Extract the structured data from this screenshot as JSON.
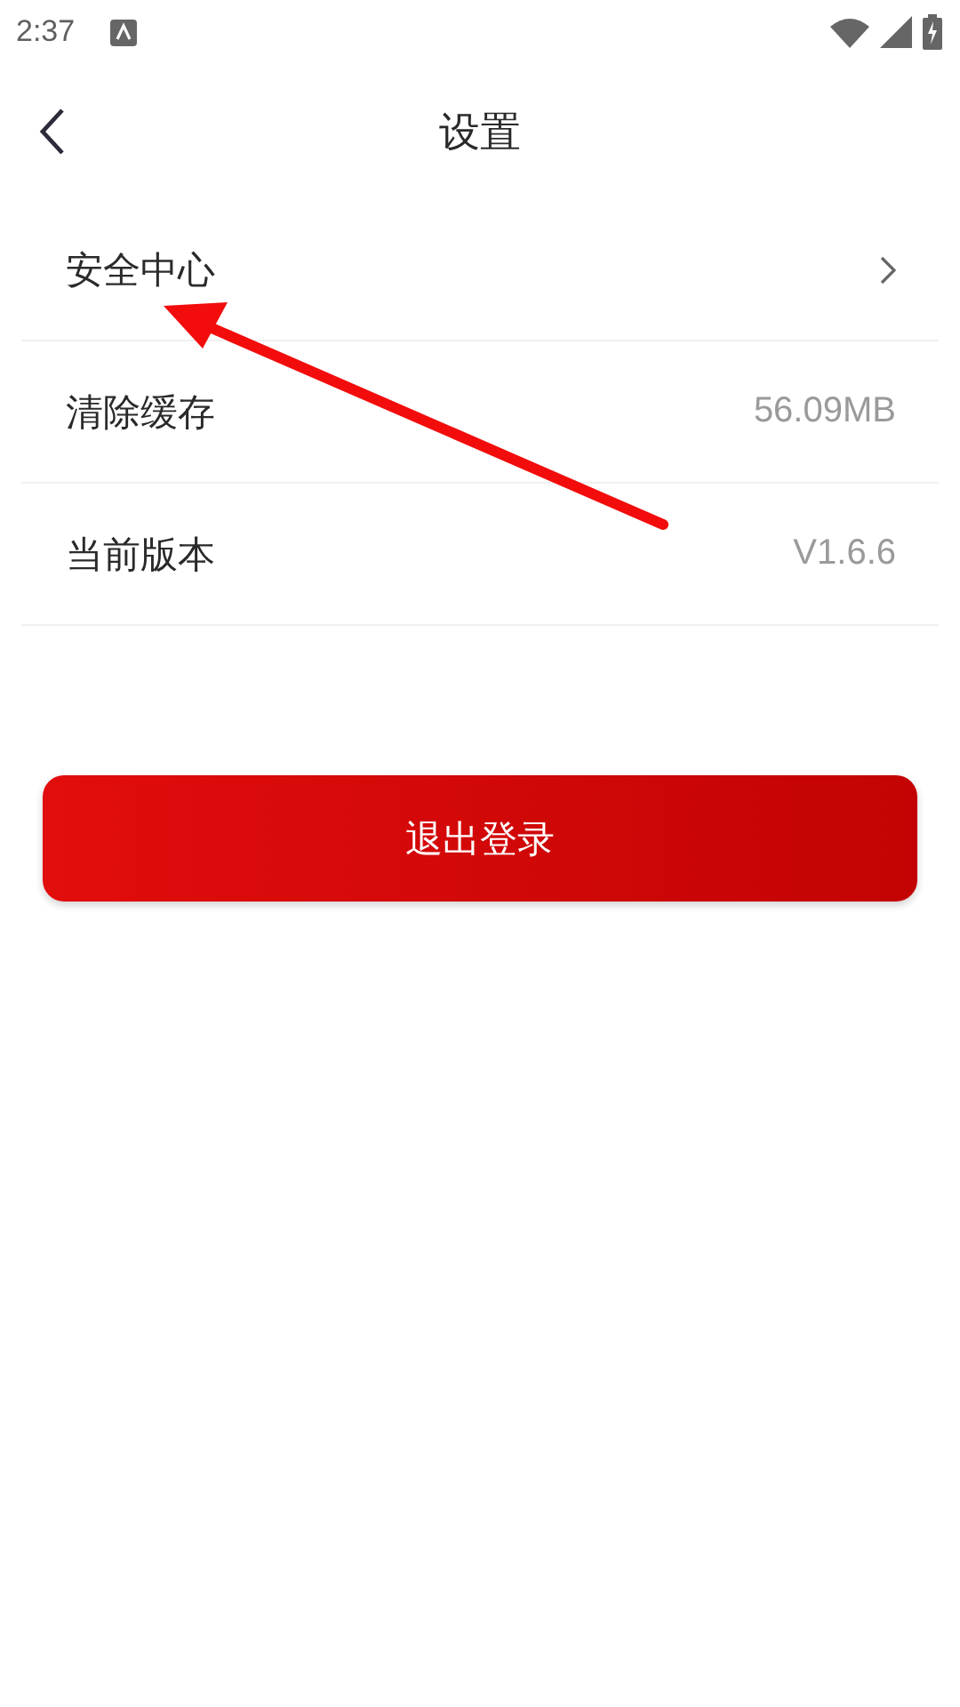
{
  "status_bar": {
    "time": "2:37"
  },
  "header": {
    "title": "设置"
  },
  "settings": [
    {
      "kind": "link",
      "label": "安全中心"
    },
    {
      "kind": "value",
      "label": "清除缓存",
      "value": "56.09MB"
    },
    {
      "kind": "value",
      "label": "当前版本",
      "value": "V1.6.6"
    }
  ],
  "logout_button": {
    "label": "退出登录"
  },
  "annotation": {
    "kind": "arrow"
  }
}
